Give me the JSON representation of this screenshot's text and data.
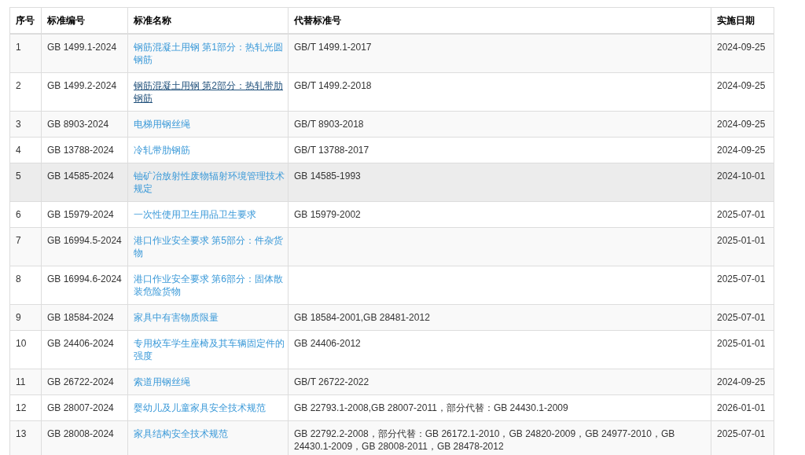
{
  "table": {
    "columns": [
      "序号",
      "标准编号",
      "标准名称",
      "代替标准号",
      "实施日期"
    ],
    "rows": [
      {
        "no": "1",
        "code": "GB 1499.1-2024",
        "name": "钢筋混凝土用钢 第1部分：热轧光圆钢筋",
        "name_underlined": false,
        "replaces": "GB/T 1499.1-2017",
        "date": "2024-09-25",
        "highlighted": false
      },
      {
        "no": "2",
        "code": "GB 1499.2-2024",
        "name": "钢筋混凝土用钢 第2部分：热轧带肋钢筋",
        "name_underlined": true,
        "replaces": "GB/T 1499.2-2018",
        "date": "2024-09-25",
        "highlighted": false
      },
      {
        "no": "3",
        "code": "GB 8903-2024",
        "name": "电梯用钢丝绳",
        "name_underlined": false,
        "replaces": "GB/T 8903-2018",
        "date": "2024-09-25",
        "highlighted": false
      },
      {
        "no": "4",
        "code": "GB 13788-2024",
        "name": "冷轧带肋钢筋",
        "name_underlined": false,
        "replaces": "GB/T 13788-2017",
        "date": "2024-09-25",
        "highlighted": false
      },
      {
        "no": "5",
        "code": "GB 14585-2024",
        "name": "铀矿冶放射性废物辐射环境管理技术规定",
        "name_underlined": false,
        "replaces": "GB 14585-1993",
        "date": "2024-10-01",
        "highlighted": true
      },
      {
        "no": "6",
        "code": "GB 15979-2024",
        "name": "一次性使用卫生用品卫生要求",
        "name_underlined": false,
        "replaces": "GB 15979-2002",
        "date": "2025-07-01",
        "highlighted": false
      },
      {
        "no": "7",
        "code": "GB 16994.5-2024",
        "name": "港口作业安全要求 第5部分：件杂货物",
        "name_underlined": false,
        "date": "2025-01-01",
        "highlighted": false
      },
      {
        "no": "8",
        "code": "GB 16994.6-2024",
        "name": "港口作业安全要求 第6部分：固体散装危险货物",
        "name_underlined": false,
        "date": "2025-07-01",
        "highlighted": false
      },
      {
        "no": "9",
        "code": "GB 18584-2024",
        "name": "家具中有害物质限量",
        "name_underlined": false,
        "replaces": "GB 18584-2001,GB 28481-2012",
        "date": "2025-07-01",
        "highlighted": false
      },
      {
        "no": "10",
        "code": "GB 24406-2024",
        "name": "专用校车学生座椅及其车辆固定件的强度",
        "name_underlined": false,
        "replaces": "GB 24406-2012",
        "date": "2025-01-01",
        "highlighted": false
      },
      {
        "no": "11",
        "code": "GB 26722-2024",
        "name": "索道用钢丝绳",
        "name_underlined": false,
        "replaces": "GB/T 26722-2022",
        "date": "2024-09-25",
        "highlighted": false
      },
      {
        "no": "12",
        "code": "GB 28007-2024",
        "name": "婴幼儿及儿童家具安全技术规范",
        "name_underlined": false,
        "replaces": "GB 22793.1-2008,GB 28007-2011，部分代替：GB 24430.1-2009",
        "date": "2026-01-01",
        "highlighted": false
      },
      {
        "no": "13",
        "code": "GB 28008-2024",
        "name": "家具结构安全技术规范",
        "name_underlined": false,
        "replaces": "GB 22792.2-2008，部分代替：GB 26172.1-2010，GB 24820-2009，GB 24977-2010，GB 24430.1-2009，GB 28008-2011，GB 28478-2012",
        "date": "2025-07-01",
        "highlighted": false
      }
    ]
  }
}
